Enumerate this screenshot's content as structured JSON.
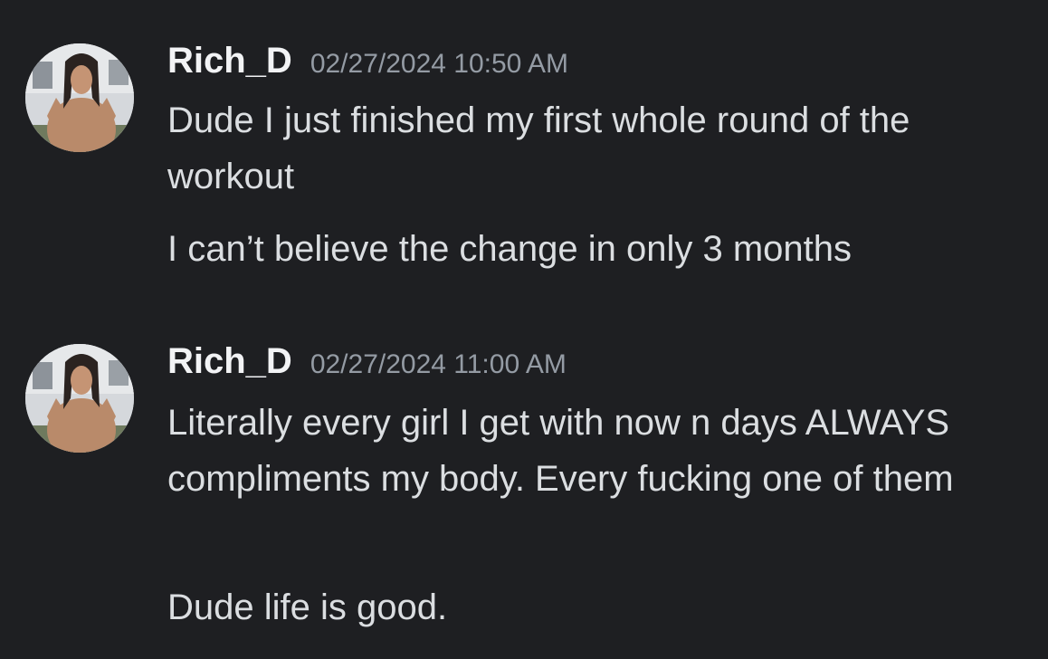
{
  "colors": {
    "background": "#1e1f22",
    "username": "#f2f3f5",
    "timestamp": "#949ba4",
    "message_text": "#dbdee1"
  },
  "messages": [
    {
      "avatar_icon": "user-avatar-icon",
      "username": "Rich_D",
      "timestamp": "02/27/2024 10:50 AM",
      "lines": [
        "Dude I just finished my first whole round of the workout",
        "I can’t believe the change in only 3 months"
      ]
    },
    {
      "avatar_icon": "user-avatar-icon",
      "username": "Rich_D",
      "timestamp": "02/27/2024 11:00 AM",
      "lines": [
        "Literally every girl I get with now n days ALWAYS compliments my body. Every fucking one of them",
        "Dude life is good."
      ]
    }
  ]
}
